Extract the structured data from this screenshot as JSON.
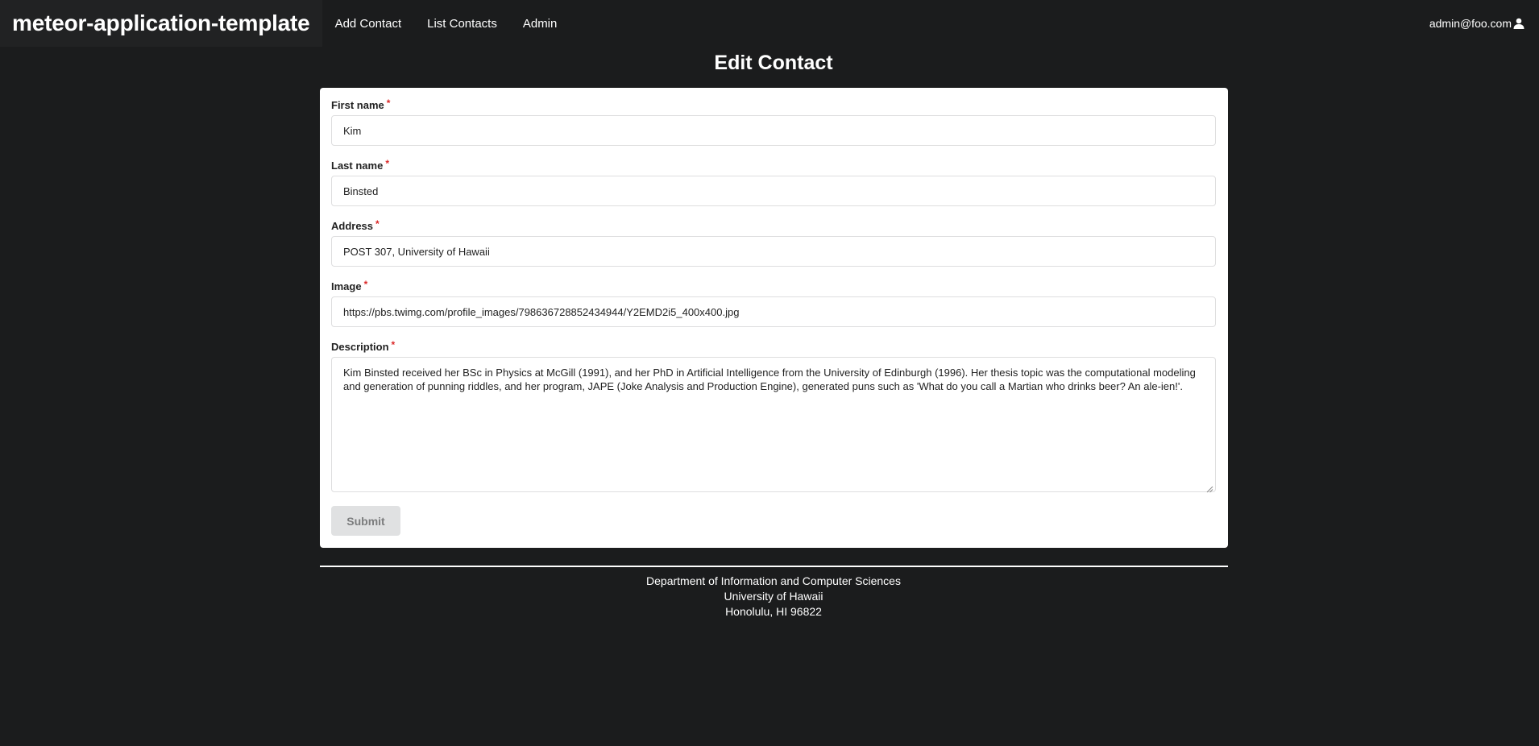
{
  "navbar": {
    "brand": "meteor-application-template",
    "items": [
      {
        "label": "Add Contact"
      },
      {
        "label": "List Contacts"
      },
      {
        "label": "Admin"
      }
    ],
    "user": "admin@foo.com",
    "user_icon": "user-icon"
  },
  "page": {
    "title": "Edit Contact"
  },
  "form": {
    "required_marker": "*",
    "first_name": {
      "label": "First name",
      "value": "Kim"
    },
    "last_name": {
      "label": "Last name",
      "value": "Binsted"
    },
    "address": {
      "label": "Address",
      "value": "POST 307, University of Hawaii"
    },
    "image": {
      "label": "Image",
      "value": "https://pbs.twimg.com/profile_images/798636728852434944/Y2EMD2i5_400x400.jpg"
    },
    "description": {
      "label": "Description",
      "value": "Kim Binsted received her BSc in Physics at McGill (1991), and her PhD in Artificial Intelligence from the University of Edinburgh (1996). Her thesis topic was the computational modeling and generation of punning riddles, and her program, JAPE (Joke Analysis and Production Engine), generated puns such as 'What do you call a Martian who drinks beer? An ale-ien!'."
    },
    "submit_label": "Submit"
  },
  "footer": {
    "line1": "Department of Information and Computer Sciences",
    "line2": "University of Hawaii",
    "line3": "Honolulu, HI 96822"
  },
  "colors": {
    "background": "#1b1c1d",
    "required": "#db2828",
    "button": "#e0e1e2"
  }
}
